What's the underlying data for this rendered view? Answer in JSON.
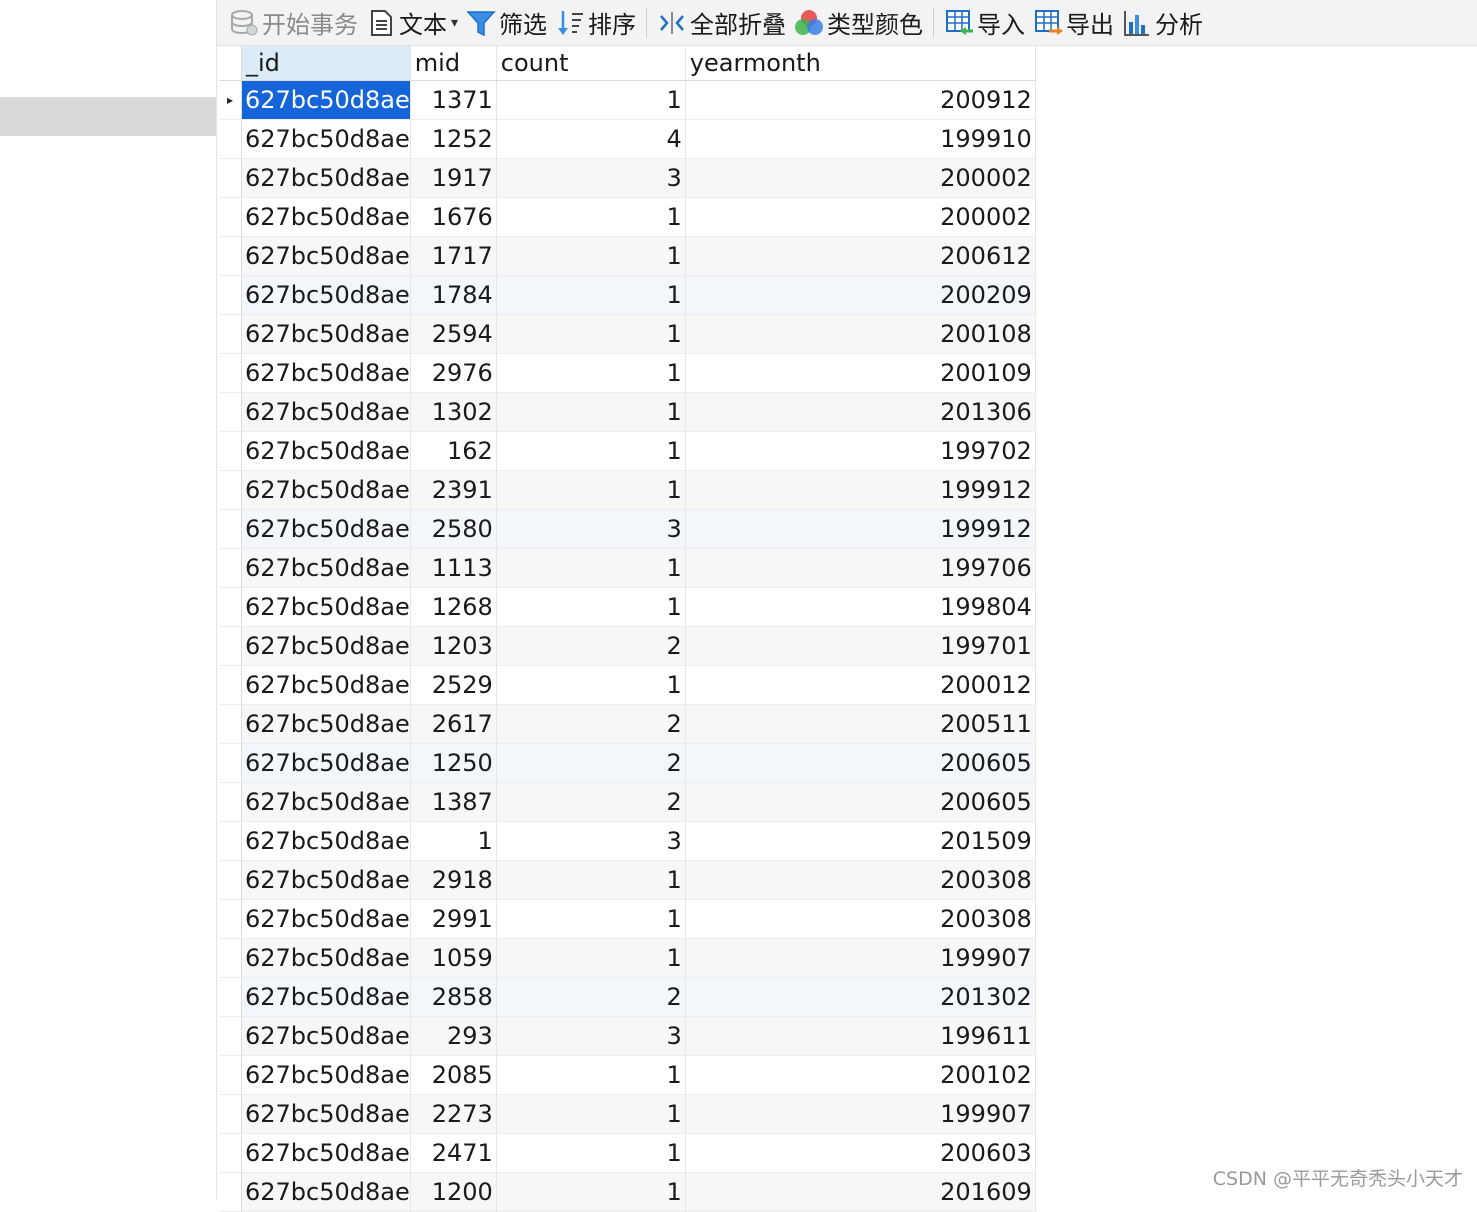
{
  "toolbar": {
    "begin_transaction": "开始事务",
    "text": "文本",
    "filter": "筛选",
    "sort": "排序",
    "collapse_all": "全部折叠",
    "type_color": "类型颜色",
    "import": "导入",
    "export": "导出",
    "analyze": "分析"
  },
  "columns": [
    "_id",
    "mid",
    "count",
    "yearmonth"
  ],
  "rows": [
    {
      "id": "627bc50d8ae",
      "mid": "1371",
      "count": "1",
      "yearmonth": "200912"
    },
    {
      "id": "627bc50d8ae",
      "mid": "1252",
      "count": "4",
      "yearmonth": "199910"
    },
    {
      "id": "627bc50d8ae",
      "mid": "1917",
      "count": "3",
      "yearmonth": "200002"
    },
    {
      "id": "627bc50d8ae",
      "mid": "1676",
      "count": "1",
      "yearmonth": "200002"
    },
    {
      "id": "627bc50d8ae",
      "mid": "1717",
      "count": "1",
      "yearmonth": "200612"
    },
    {
      "id": "627bc50d8ae",
      "mid": "1784",
      "count": "1",
      "yearmonth": "200209"
    },
    {
      "id": "627bc50d8ae",
      "mid": "2594",
      "count": "1",
      "yearmonth": "200108"
    },
    {
      "id": "627bc50d8ae",
      "mid": "2976",
      "count": "1",
      "yearmonth": "200109"
    },
    {
      "id": "627bc50d8ae",
      "mid": "1302",
      "count": "1",
      "yearmonth": "201306"
    },
    {
      "id": "627bc50d8ae",
      "mid": "162",
      "count": "1",
      "yearmonth": "199702"
    },
    {
      "id": "627bc50d8ae",
      "mid": "2391",
      "count": "1",
      "yearmonth": "199912"
    },
    {
      "id": "627bc50d8ae",
      "mid": "2580",
      "count": "3",
      "yearmonth": "199912"
    },
    {
      "id": "627bc50d8ae",
      "mid": "1113",
      "count": "1",
      "yearmonth": "199706"
    },
    {
      "id": "627bc50d8ae",
      "mid": "1268",
      "count": "1",
      "yearmonth": "199804"
    },
    {
      "id": "627bc50d8ae",
      "mid": "1203",
      "count": "2",
      "yearmonth": "199701"
    },
    {
      "id": "627bc50d8ae",
      "mid": "2529",
      "count": "1",
      "yearmonth": "200012"
    },
    {
      "id": "627bc50d8ae",
      "mid": "2617",
      "count": "2",
      "yearmonth": "200511"
    },
    {
      "id": "627bc50d8ae",
      "mid": "1250",
      "count": "2",
      "yearmonth": "200605"
    },
    {
      "id": "627bc50d8ae",
      "mid": "1387",
      "count": "2",
      "yearmonth": "200605"
    },
    {
      "id": "627bc50d8ae",
      "mid": "1",
      "count": "3",
      "yearmonth": "201509"
    },
    {
      "id": "627bc50d8ae",
      "mid": "2918",
      "count": "1",
      "yearmonth": "200308"
    },
    {
      "id": "627bc50d8ae",
      "mid": "2991",
      "count": "1",
      "yearmonth": "200308"
    },
    {
      "id": "627bc50d8ae",
      "mid": "1059",
      "count": "1",
      "yearmonth": "199907"
    },
    {
      "id": "627bc50d8ae",
      "mid": "2858",
      "count": "2",
      "yearmonth": "201302"
    },
    {
      "id": "627bc50d8ae",
      "mid": "293",
      "count": "3",
      "yearmonth": "199611"
    },
    {
      "id": "627bc50d8ae",
      "mid": "2085",
      "count": "1",
      "yearmonth": "200102"
    },
    {
      "id": "627bc50d8ae",
      "mid": "2273",
      "count": "1",
      "yearmonth": "199907"
    },
    {
      "id": "627bc50d8ae",
      "mid": "2471",
      "count": "1",
      "yearmonth": "200603"
    },
    {
      "id": "627bc50d8ae",
      "mid": "1200",
      "count": "1",
      "yearmonth": "201609"
    }
  ],
  "selected_row": 0,
  "watermark": "CSDN @平平无奇秃头小天才",
  "colors": {
    "selection": "#1565d8",
    "header_selected": "#dcebf8"
  }
}
